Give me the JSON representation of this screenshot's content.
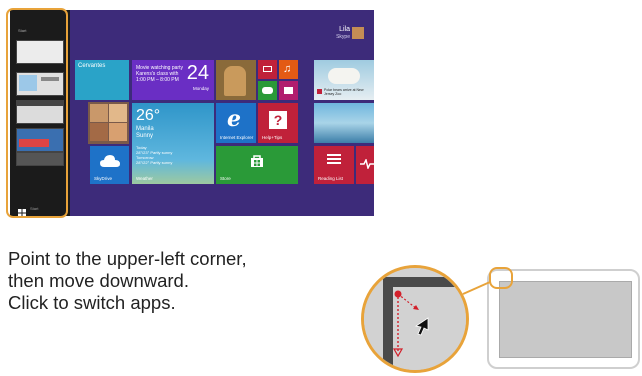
{
  "start_screen": {
    "user_name": "Lila",
    "user_subtitle": "Skype",
    "tiles": {
      "cervantes": "Cervantes",
      "calendar_text": [
        "Movie watching party",
        "Karens's class with",
        "1:00 PM – 8:00 PM"
      ],
      "calendar_number": "24",
      "calendar_day": "Monday",
      "weather_temp": "26°",
      "weather_city": "Manila",
      "weather_cond": "Sunny",
      "weather_today": "Today",
      "weather_today_val": "28°/23° Partly sunny",
      "weather_tomorrow": "Tomorrow",
      "weather_tomorrow_val": "28°/22° Partly sunny",
      "skydrive_label": "SkyDrive",
      "weather_label": "Weather",
      "ie_label": "Internet Explorer",
      "help_label": "Help+Tips",
      "store_label": "Store",
      "news_text": "Polar bears arrive at New Jersey Zoo",
      "reading_label": "Reading List"
    },
    "switcher": {
      "top_label": "Start",
      "bottom_label": "Start"
    }
  },
  "instruction": {
    "line1": "Point to the upper-left corner,",
    "line2": "then move downward.",
    "line3": "Click to switch apps."
  },
  "colors": {
    "accent_orange": "#e8a33a",
    "start_bg": "#3d2b7a",
    "tile_blue": "#1e72c8",
    "tile_green": "#2a9a38",
    "tile_red": "#c0213a",
    "tile_purple": "#6a2ec4",
    "pointer_red": "#d21f2a"
  },
  "icons": [
    "skydrive-cloud-icon",
    "internet-explorer-icon",
    "help-icon",
    "store-icon",
    "camera-icon",
    "music-icon",
    "game-icon",
    "video-icon",
    "reading-list-icon",
    "health-icon",
    "mouse-pointer-icon",
    "windows-logo-icon"
  ]
}
